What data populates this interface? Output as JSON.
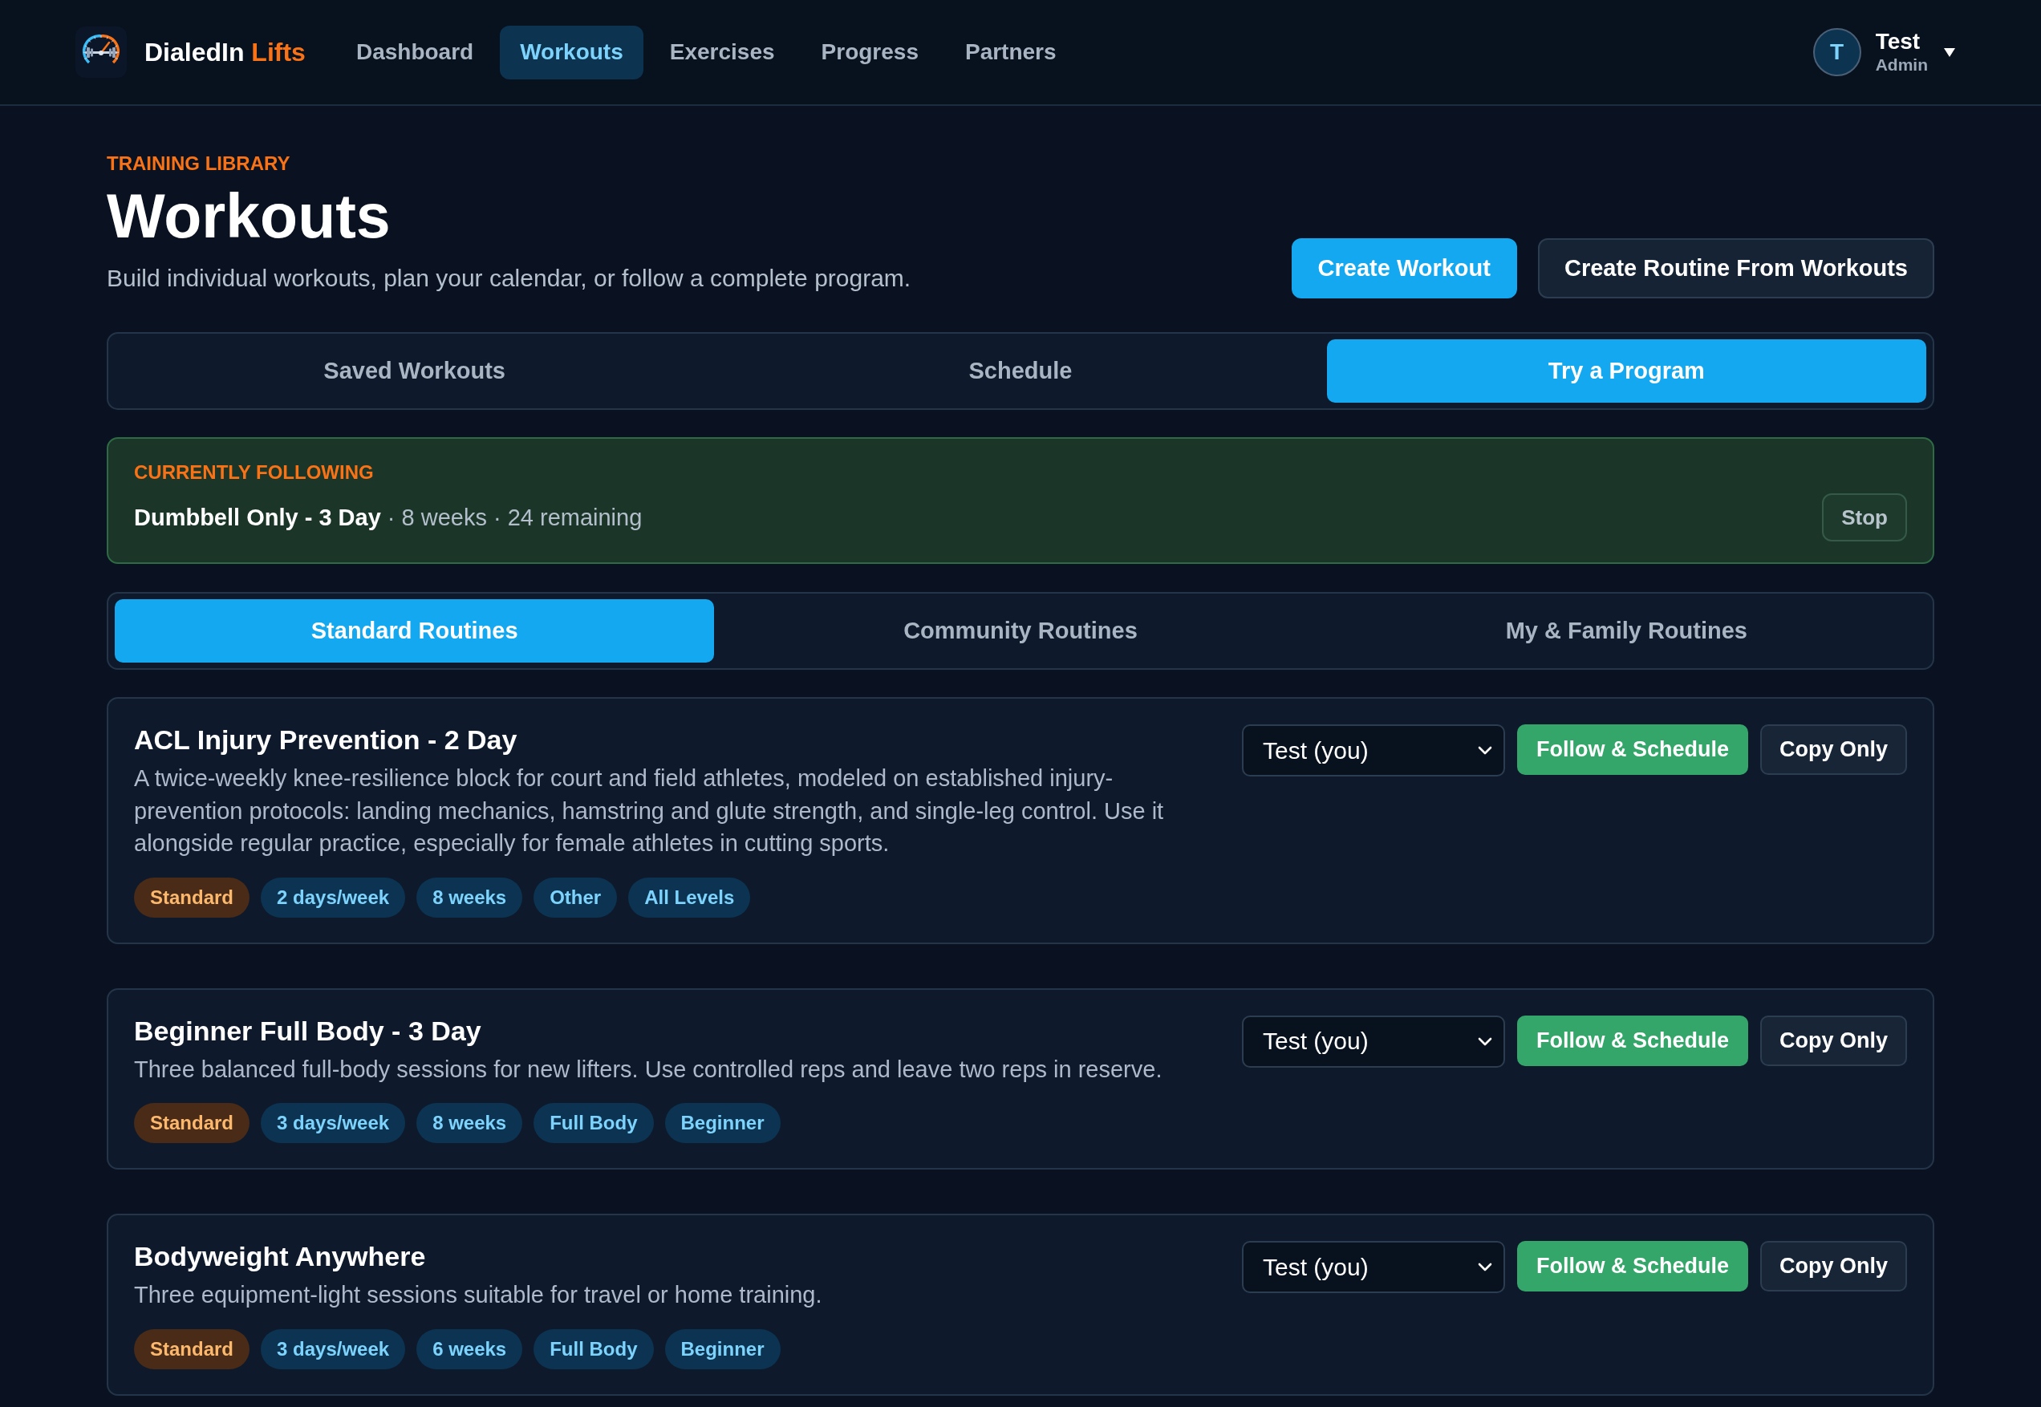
{
  "header": {
    "brand": {
      "name": "DialedIn",
      "accent": "Lifts"
    },
    "nav": [
      {
        "label": "Dashboard",
        "selected": false
      },
      {
        "label": "Workouts",
        "selected": true
      },
      {
        "label": "Exercises",
        "selected": false
      },
      {
        "label": "Progress",
        "selected": false
      },
      {
        "label": "Partners",
        "selected": false
      }
    ],
    "user": {
      "initial": "T",
      "name": "Test",
      "role": "Admin"
    }
  },
  "page": {
    "eyebrow": "TRAINING LIBRARY",
    "title": "Workouts",
    "subtitle": "Build individual workouts, plan your calendar, or follow a complete program.",
    "actions": [
      {
        "label": "Create Workout",
        "kind": "primary"
      },
      {
        "label": "Create Routine From Workouts",
        "kind": "secondary"
      }
    ]
  },
  "view_tabs": [
    {
      "label": "Saved Workouts",
      "selected": false
    },
    {
      "label": "Schedule",
      "selected": false
    },
    {
      "label": "Try a Program",
      "selected": true
    }
  ],
  "currently_following": {
    "label": "CURRENTLY FOLLOWING",
    "program": "Dumbbell Only - 3 Day",
    "details": "· 8 weeks · 24 remaining",
    "stop": "Stop"
  },
  "routine_tabs": [
    {
      "label": "Standard Routines",
      "selected": true
    },
    {
      "label": "Community Routines",
      "selected": false
    },
    {
      "label": "My & Family Routines",
      "selected": false
    }
  ],
  "routines": [
    {
      "title": "ACL Injury Prevention - 2 Day",
      "description": "A twice-weekly knee-resilience block for court and field athletes, modeled on established injury-prevention protocols: landing mechanics, hamstring and glute strength, and single-leg control. Use it alongside regular practice, especially for female athletes in cutting sports.",
      "tags": [
        {
          "label": "Standard",
          "kind": "source"
        },
        {
          "label": "2 days/week",
          "kind": "info"
        },
        {
          "label": "8 weeks",
          "kind": "info"
        },
        {
          "label": "Other",
          "kind": "info"
        },
        {
          "label": "All Levels",
          "kind": "info"
        }
      ],
      "assignee": "Test (you)",
      "follow": "Follow & Schedule",
      "copy": "Copy Only"
    },
    {
      "title": "Beginner Full Body - 3 Day",
      "description": "Three balanced full-body sessions for new lifters. Use controlled reps and leave two reps in reserve.",
      "tags": [
        {
          "label": "Standard",
          "kind": "source"
        },
        {
          "label": "3 days/week",
          "kind": "info"
        },
        {
          "label": "8 weeks",
          "kind": "info"
        },
        {
          "label": "Full Body",
          "kind": "info"
        },
        {
          "label": "Beginner",
          "kind": "info"
        }
      ],
      "assignee": "Test (you)",
      "follow": "Follow & Schedule",
      "copy": "Copy Only"
    },
    {
      "title": "Bodyweight Anywhere",
      "description": "Three equipment-light sessions suitable for travel or home training.",
      "tags": [
        {
          "label": "Standard",
          "kind": "source"
        },
        {
          "label": "3 days/week",
          "kind": "info"
        },
        {
          "label": "6 weeks",
          "kind": "info"
        },
        {
          "label": "Full Body",
          "kind": "info"
        },
        {
          "label": "Beginner",
          "kind": "info"
        }
      ],
      "assignee": "Test (you)",
      "follow": "Follow & Schedule",
      "copy": "Copy Only"
    }
  ]
}
